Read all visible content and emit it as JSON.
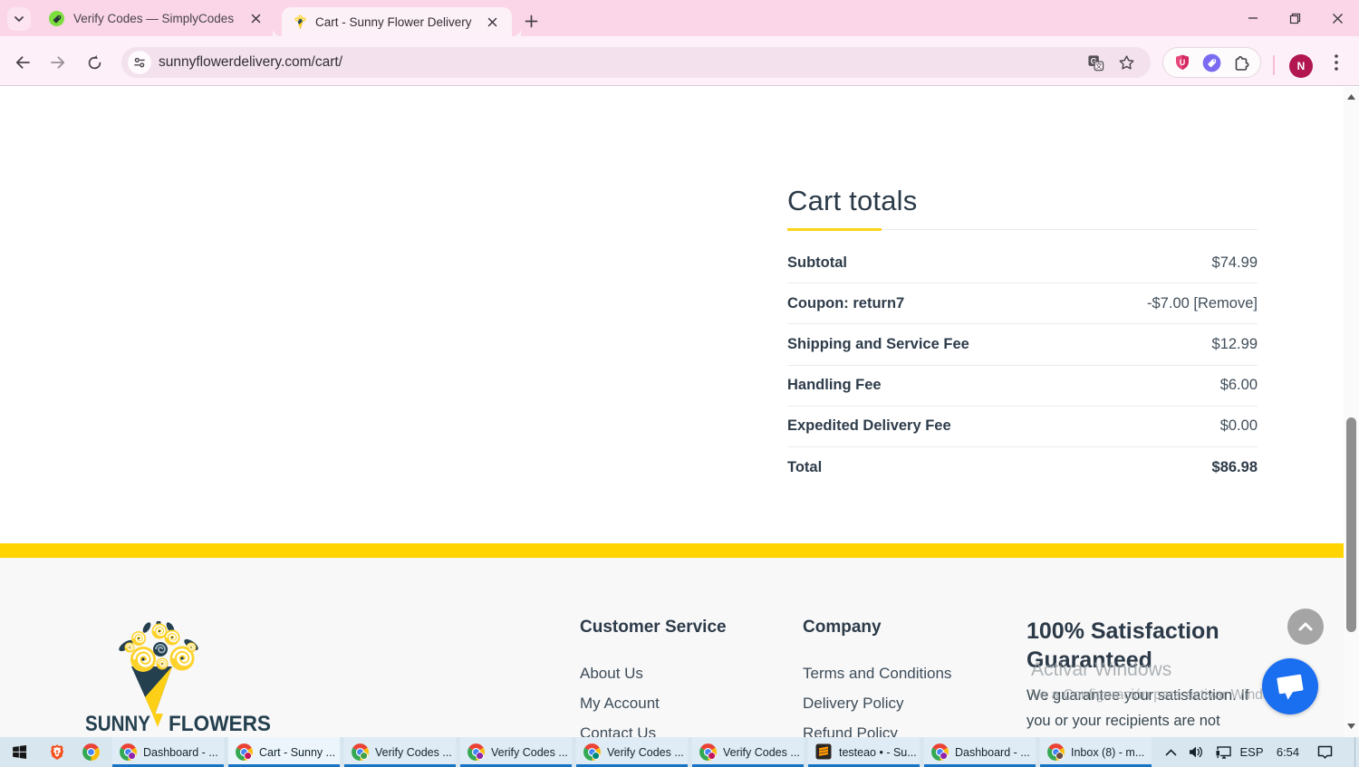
{
  "browser": {
    "tabs": {
      "inactive": {
        "title": "Verify Codes — SimplyCodes"
      },
      "active": {
        "title": "Cart - Sunny Flower Delivery"
      }
    },
    "url": "sunnyflowerdelivery.com/cart/",
    "profile_initial": "N",
    "ublock_letter": "U"
  },
  "page": {
    "cart_totals": {
      "title": "Cart totals",
      "rows": [
        {
          "label": "Subtotal",
          "value": "$74.99",
          "total": false
        },
        {
          "label": "Coupon: return7",
          "value": "-$7.00 [Remove]",
          "total": false
        },
        {
          "label": "Shipping and Service Fee",
          "value": "$12.99",
          "total": false
        },
        {
          "label": "Handling Fee",
          "value": "$6.00",
          "total": false
        },
        {
          "label": "Expedited Delivery Fee",
          "value": "$0.00",
          "total": false
        },
        {
          "label": "Total",
          "value": "$86.98",
          "total": true
        }
      ]
    },
    "footer": {
      "logo": {
        "word1": "SUNNY",
        "word2": "FLOWERS"
      },
      "customer_service": {
        "heading": "Customer Service",
        "links": [
          "About Us",
          "My Account",
          "Contact Us"
        ]
      },
      "company": {
        "heading": "Company",
        "links": [
          "Terms and Conditions",
          "Delivery Policy",
          "Refund Policy"
        ]
      },
      "satisfaction": {
        "heading": "100% Satisfaction Guaranteed",
        "text": "We guarantee your satisfaction. If you or your recipients are not"
      }
    },
    "watermark": {
      "line1": "Activar Windows",
      "line2": "Ve a Configuración para activar Windows."
    }
  },
  "taskbar": {
    "items": [
      {
        "label": "Dashboard - ...",
        "badge": "#8e24aa",
        "active": false,
        "sublime": false
      },
      {
        "label": "Cart - Sunny ...",
        "badge": "#c2185b",
        "active": true,
        "sublime": false
      },
      {
        "label": "Verify Codes ...",
        "badge": "#43a047",
        "active": false,
        "sublime": false
      },
      {
        "label": "Verify Codes ...",
        "badge": "#8e24aa",
        "active": false,
        "sublime": false
      },
      {
        "label": "Verify Codes ...",
        "badge": "#00897b",
        "active": false,
        "sublime": false
      },
      {
        "label": "Verify Codes ...",
        "badge": "#c2185b",
        "active": false,
        "sublime": false
      },
      {
        "label": "testeao • - Su...",
        "badge": "",
        "active": false,
        "sublime": true
      },
      {
        "label": "Dashboard - ...",
        "badge": "#8e24aa",
        "active": false,
        "sublime": false
      },
      {
        "label": "Inbox (8) - m...",
        "badge": "#6d4c41",
        "active": false,
        "sublime": false
      }
    ],
    "tray": {
      "language": "ESP",
      "time": "6:54"
    }
  }
}
